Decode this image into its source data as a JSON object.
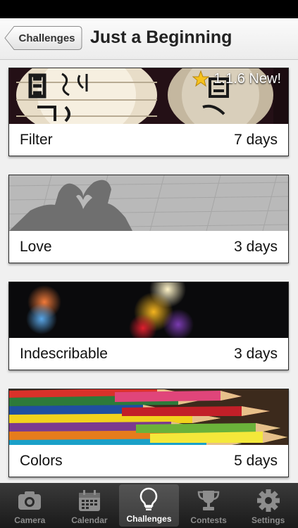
{
  "nav": {
    "back_label": "Challenges",
    "title": "Just a Beginning"
  },
  "badge": {
    "text": "1.1.6 New!"
  },
  "cards": [
    {
      "name": "Filter",
      "duration": "7 days"
    },
    {
      "name": "Love",
      "duration": "3 days"
    },
    {
      "name": "Indescribable",
      "duration": "3 days"
    },
    {
      "name": "Colors",
      "duration": "5 days"
    }
  ],
  "tabs": [
    {
      "label": "Camera",
      "icon": "camera-icon"
    },
    {
      "label": "Calendar",
      "icon": "calendar-icon"
    },
    {
      "label": "Challenges",
      "icon": "lightbulb-icon",
      "active": true
    },
    {
      "label": "Contests",
      "icon": "trophy-icon"
    },
    {
      "label": "Settings",
      "icon": "gear-icon"
    }
  ]
}
